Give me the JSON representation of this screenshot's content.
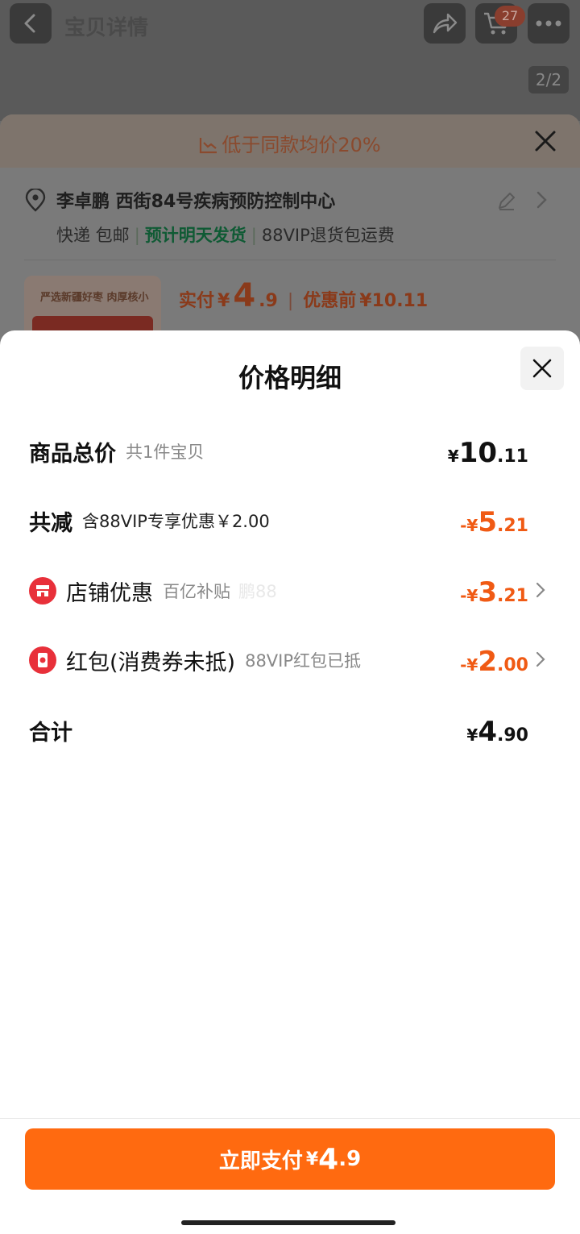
{
  "background": {
    "title": "宝贝详情",
    "cart_count": "27",
    "page_indicator": "2/2",
    "banner": "低于同款均价20%",
    "address_line": "李卓鹏 西街84号疾病预防控制中心",
    "shipping": {
      "method": "快递 包邮",
      "eta": "预计明天发货",
      "return_note": "88VIP退货包运费"
    },
    "product_caption": "严选新疆好枣 肉厚核小",
    "price": {
      "paid_label": "实付",
      "yen": "¥",
      "paid_int": "4",
      "paid_dec": ".9",
      "before_label": "优惠前",
      "before_value": "¥10.11"
    }
  },
  "sheet": {
    "title": "价格明细",
    "rows": [
      {
        "title": "商品总价",
        "sub": "共1件宝贝",
        "sign": "",
        "yen": "¥",
        "int": "10",
        "dec": ".11"
      },
      {
        "title": "共减",
        "sub": "含88VIP专享优惠￥2.00",
        "sign": "-",
        "yen": "¥",
        "int": "5",
        "dec": ".21"
      },
      {
        "title": "店铺优惠",
        "sub": "百亿补贴",
        "extra": "鹏88",
        "sign": "-",
        "yen": "¥",
        "int": "3",
        "dec": ".21"
      },
      {
        "title": "红包(消费券未抵)",
        "sub": "88VIP红包已抵",
        "sign": "-",
        "yen": "¥",
        "int": "2",
        "dec": ".00"
      },
      {
        "title": "合计",
        "sub": "",
        "sign": "",
        "yen": "¥",
        "int": "4",
        "dec": ".90"
      }
    ],
    "pay_button": {
      "label": "立即支付",
      "yen": "¥",
      "int": "4",
      "dec": ".9"
    }
  },
  "colors": {
    "accent": "#ff6a10",
    "discount": "#f05a14",
    "shop_icon": "#e8303a"
  },
  "icons": [
    "back-icon",
    "share-icon",
    "cart-icon",
    "more-icon",
    "trend-icon",
    "close-icon",
    "location-icon",
    "edit-icon",
    "chevron-right-icon",
    "shop-icon",
    "red-packet-icon"
  ]
}
